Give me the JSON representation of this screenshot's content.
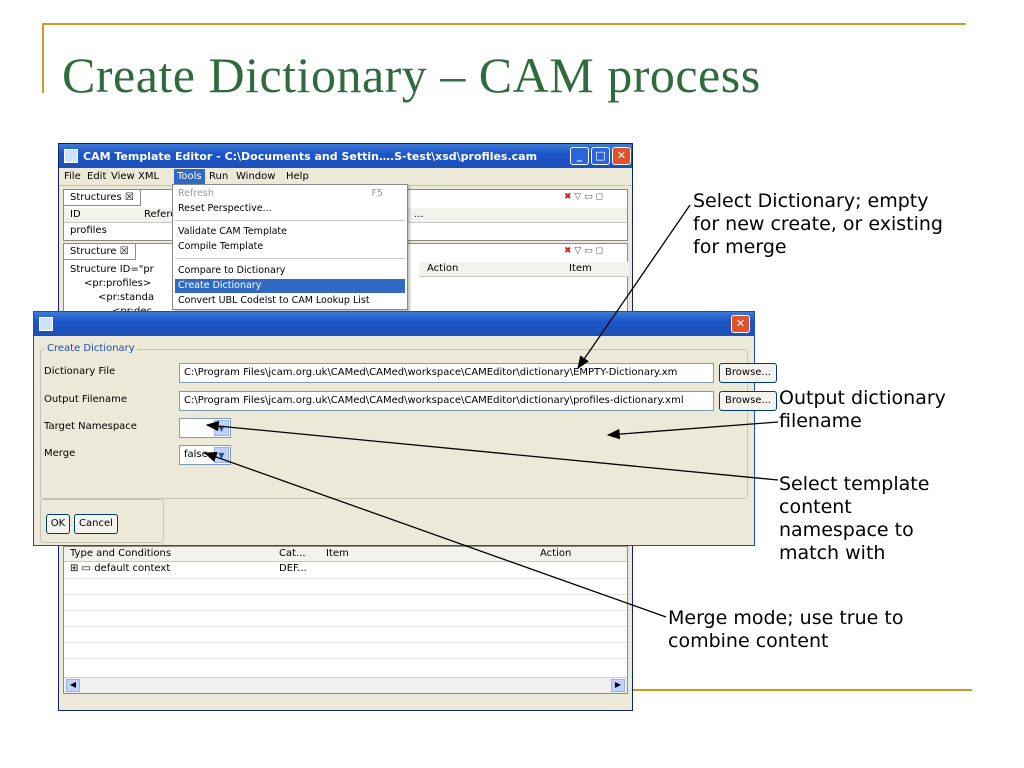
{
  "slide": {
    "title": "Create Dictionary – CAM process"
  },
  "window": {
    "title": "CAM Template Editor - C:\\Documents and Settin….S-test\\xsd\\profiles.cam",
    "min_icon": "minimize-icon",
    "max_icon": "maximize-icon",
    "close_icon": "close-icon"
  },
  "menubar": {
    "items": [
      "File",
      "Edit",
      "View",
      "XML",
      "Tools",
      "Run",
      "Window",
      "Help"
    ],
    "active": "Tools"
  },
  "structures_panel": {
    "tab": "Structures ☒",
    "columns": [
      "ID",
      "Referer",
      "..."
    ],
    "rows": [
      "profiles"
    ]
  },
  "structure_panel": {
    "tab": "Structure ☒",
    "columns": [
      "Action",
      "Item"
    ],
    "tree": [
      "Structure ID=\"pr",
      "<pr:profiles>",
      "<pr:standa",
      "<pr:dec"
    ]
  },
  "context_panel": {
    "columns": [
      "Type and Conditions",
      "Cat...",
      "Item",
      "Action"
    ],
    "rows": [
      {
        "type": "default context",
        "cat": "DEF..."
      }
    ]
  },
  "tools_menu": {
    "items": [
      {
        "label": "Refresh",
        "shortcut": "F5",
        "disabled": true
      },
      {
        "label": "Reset Perspective..."
      },
      {
        "label": "Validate CAM Template"
      },
      {
        "label": "Compile Template"
      },
      {
        "label": "Compare to Dictionary"
      },
      {
        "label": "Create Dictionary",
        "selected": true
      },
      {
        "label": "Convert UBL Codelst to CAM Lookup List"
      }
    ]
  },
  "dialog": {
    "group_label": "Create Dictionary",
    "dictionary_file": {
      "label": "Dictionary File",
      "value": "C:\\Program Files\\jcam.org.uk\\CAMed\\CAMed\\workspace\\CAMEditor\\dictionary\\EMPTY-Dictionary.xm"
    },
    "output_filename": {
      "label": "Output Filename",
      "value": "C:\\Program Files\\jcam.org.uk\\CAMed\\CAMed\\workspace\\CAMEditor\\dictionary\\profiles-dictionary.xml"
    },
    "browse_label": "Browse...",
    "target_namespace": {
      "label": "Target Namespace",
      "value": ""
    },
    "merge": {
      "label": "Merge",
      "value": "false"
    },
    "ok_label": "OK",
    "cancel_label": "Cancel"
  },
  "annotations": {
    "select_dictionary": [
      "Select Dictionary; empty",
      "for new create, or existing",
      "for merge"
    ],
    "output_filename": [
      "Output dictionary",
      "filename"
    ],
    "namespace": [
      "Select template",
      "content",
      "namespace to",
      "match with"
    ],
    "merge": [
      "Merge mode; use true to",
      "combine content"
    ]
  },
  "colors": {
    "title_green": "#2f6b3d",
    "accent_gold": "#d19a1c",
    "xp_blue": "#1d55c9",
    "xp_close": "#e1512b"
  }
}
